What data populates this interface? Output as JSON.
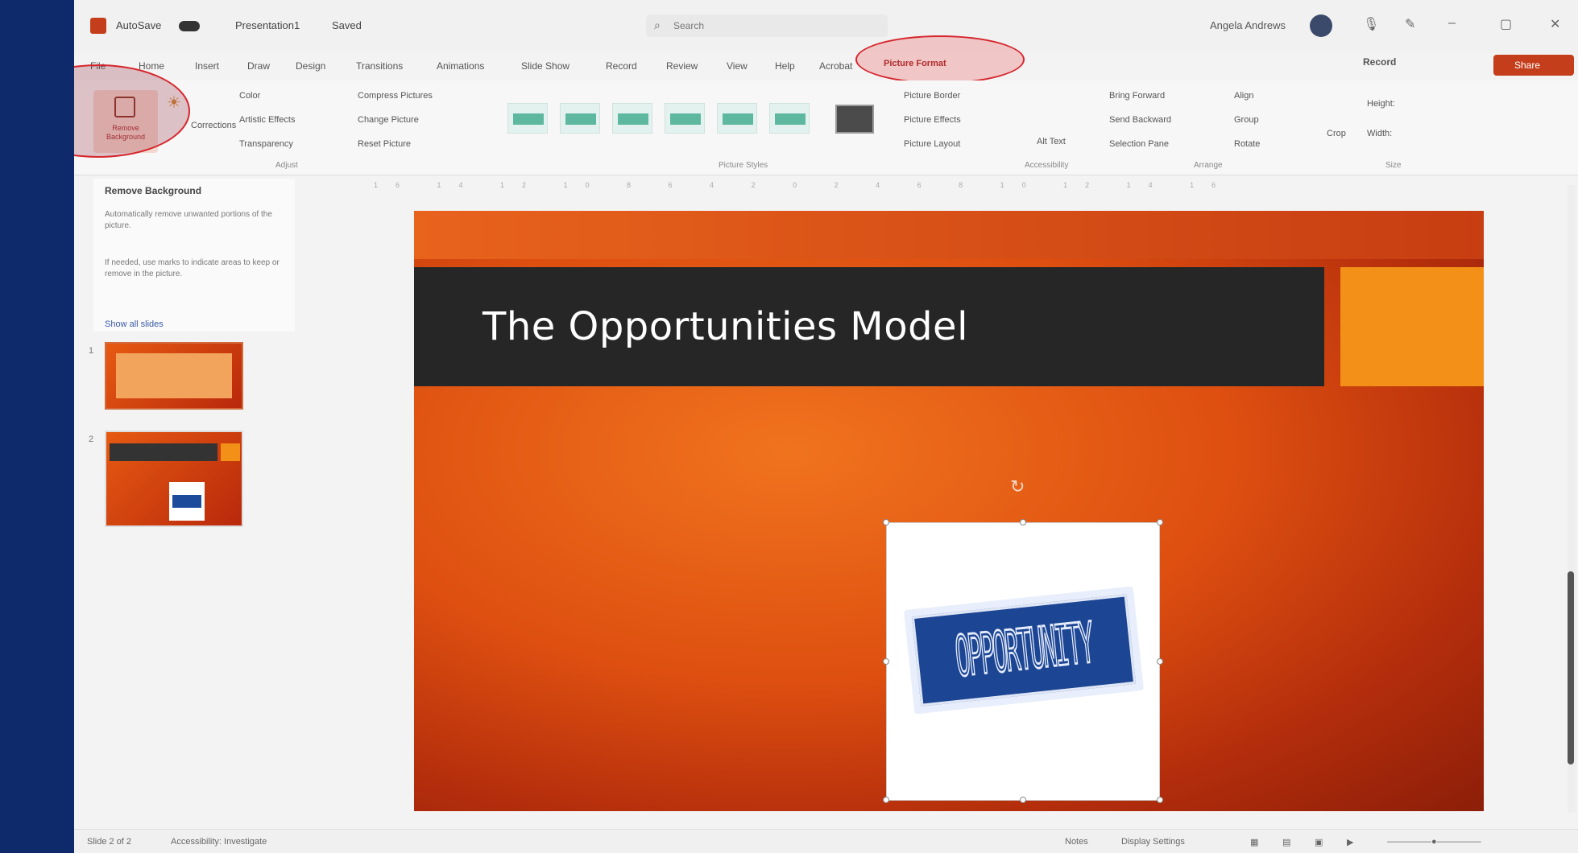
{
  "window": {
    "autosave": "AutoSave",
    "file_name": "Presentation1",
    "saved_state": "Saved",
    "search_placeholder": "Search",
    "user_name": "Angela Andrews"
  },
  "ribbon_tabs": [
    "File",
    "Home",
    "Insert",
    "Draw",
    "Design",
    "Transitions",
    "Animations",
    "Slide Show",
    "Record",
    "Review",
    "View",
    "Help",
    "Acrobat",
    "Picture Format"
  ],
  "active_tab": "Picture Format",
  "actions": {
    "record": "Record",
    "share": "Share"
  },
  "ribbon": {
    "remove_background": "Remove Background",
    "corrections": "Corrections",
    "color": "Color",
    "artistic_effects": "Artistic Effects",
    "transparency": "Transparency",
    "compress_pictures": "Compress Pictures",
    "change_picture": "Change Picture",
    "reset_picture": "Reset Picture",
    "picture_border": "Picture Border",
    "picture_effects": "Picture Effects",
    "picture_layout": "Picture Layout",
    "alt_text": "Alt Text",
    "bring_forward": "Bring Forward",
    "send_backward": "Send Backward",
    "selection_pane": "Selection Pane",
    "align": "Align",
    "group": "Group",
    "rotate": "Rotate",
    "crop": "Crop",
    "height": "Height:",
    "width": "Width:",
    "groups": {
      "adjust": "Adjust",
      "styles": "Picture Styles",
      "accessibility": "Accessibility",
      "arrange": "Arrange",
      "size": "Size"
    }
  },
  "side_panel": {
    "title": "Remove Background",
    "line1": "Automatically remove unwanted portions of the picture.",
    "line2": "If needed, use marks to indicate areas to keep or remove in the picture.",
    "checkbox": "Show all slides"
  },
  "slides": {
    "numbers": [
      "1",
      "2"
    ]
  },
  "slide": {
    "title": "The Opportunities Model",
    "image_text": "OPPORTUNITY"
  },
  "status": {
    "slide_info": "Slide 2 of 2",
    "accessibility": "Accessibility: Investigate",
    "notes": "Notes",
    "display_settings": "Display Settings"
  },
  "colors": {
    "accent": "#c43e1c",
    "slide_orange": "#de4f10",
    "title_bar": "#262626",
    "highlight_red": "#d6262c",
    "sign_blue": "#1c4594",
    "page_background": "#0f2a6b"
  }
}
